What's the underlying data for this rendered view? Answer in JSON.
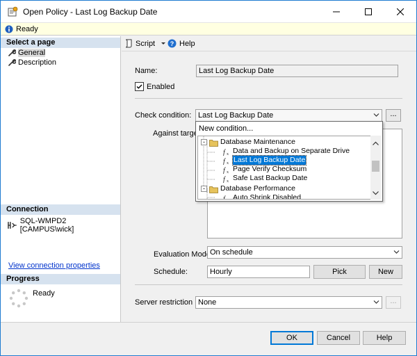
{
  "window": {
    "title": "Open Policy - Last Log Backup Date",
    "status": "Ready"
  },
  "left": {
    "select_page_header": "Select a page",
    "pages": [
      "General",
      "Description"
    ],
    "connection_header": "Connection",
    "connection": "SQL-WMPD2 [CAMPUS\\wick]",
    "view_link": "View connection properties",
    "progress_header": "Progress",
    "progress_status": "Ready"
  },
  "toolbar": {
    "script_label": "Script",
    "help_label": "Help"
  },
  "form": {
    "name_label": "Name:",
    "name_value": "Last Log Backup Date",
    "enabled_label": "Enabled",
    "enabled_checked": true,
    "check_condition_label": "Check condition:",
    "check_condition_value": "Last Log Backup Date",
    "ellipsis": "...",
    "against_targets_label": "Against targets:",
    "evaluation_mode_label": "Evaluation Mode:",
    "evaluation_mode_value": "On schedule",
    "schedule_label": "Schedule:",
    "schedule_value": "Hourly",
    "pick_label": "Pick",
    "new_label": "New",
    "server_restriction_label": "Server restriction",
    "server_restriction_value": "None"
  },
  "dropdown": {
    "new_condition": "New condition...",
    "tree": [
      {
        "label": "Database Maintenance",
        "kind": "folder",
        "expander": "-"
      },
      {
        "label": "Data and Backup on Separate Drive",
        "kind": "condition"
      },
      {
        "label": "Last Log Backup Date",
        "kind": "condition",
        "selected": true
      },
      {
        "label": "Page Verify Checksum",
        "kind": "condition"
      },
      {
        "label": "Safe Last Backup Date",
        "kind": "condition"
      },
      {
        "label": "Database Performance",
        "kind": "folder",
        "expander": "-"
      },
      {
        "label": "Auto Shrink Disabled",
        "kind": "condition"
      }
    ]
  },
  "buttons": {
    "ok": "OK",
    "cancel": "Cancel",
    "help": "Help"
  },
  "colors": {
    "accent": "#0078d7",
    "section_header_bg": "#d6e2ef",
    "info_bar_bg": "#ffffe1",
    "link": "#0033cc"
  }
}
